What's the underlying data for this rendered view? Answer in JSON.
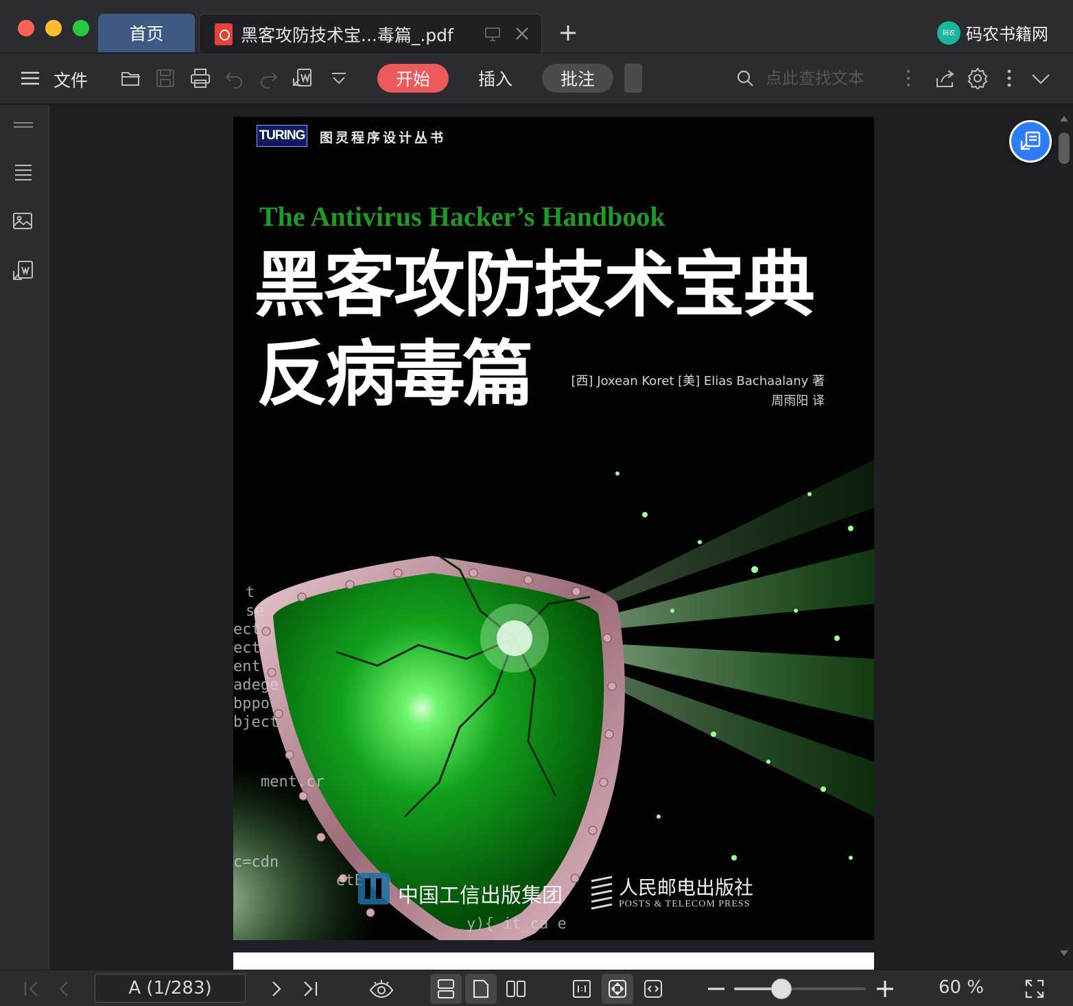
{
  "window": {
    "tabs": {
      "home": "首页",
      "document": "黑客攻防技术宝...毒篇_.pdf"
    },
    "brand": {
      "logo_text": "码农",
      "name": "码农书籍网"
    }
  },
  "toolbar": {
    "menu_label": "文件",
    "tabs": {
      "start": "开始",
      "insert": "插入",
      "annotate": "批注"
    },
    "search_placeholder": "点此查找文本"
  },
  "document": {
    "cover": {
      "publisher_series_logo": "TURING",
      "series": "图灵程序设计丛书",
      "title_en": "The Antivirus Hacker’s Handbook",
      "title_cn": "黑客攻防技术宝典",
      "subtitle_cn": "反病毒篇",
      "authors": "[西] Joxean Koret [美] Elias Bachaalany 著",
      "translator": "周雨阳 译",
      "publisher_group": "中国工信出版集团",
      "publisher": "人民邮电出版社",
      "publisher_en": "POSTS & TELECOM PRESS",
      "code_fragments": [
        "t",
        "se",
        "ect",
        "ect",
        "ent",
        "adege",
        "bppo",
        "bject",
        "ment.cr",
        "c=cdn",
        "etElem",
        "y){",
        "it_ca",
        "e"
      ]
    }
  },
  "statusbar": {
    "page_indicator": "A (1/283)",
    "zoom_label": "60 %",
    "zoom_level_percent": 60
  },
  "colors": {
    "accent_red": "#ee5a5b",
    "accent_blue": "#2e7cf6",
    "home_tab": "#3e5a82",
    "cover_green": "#1f9a2a"
  }
}
